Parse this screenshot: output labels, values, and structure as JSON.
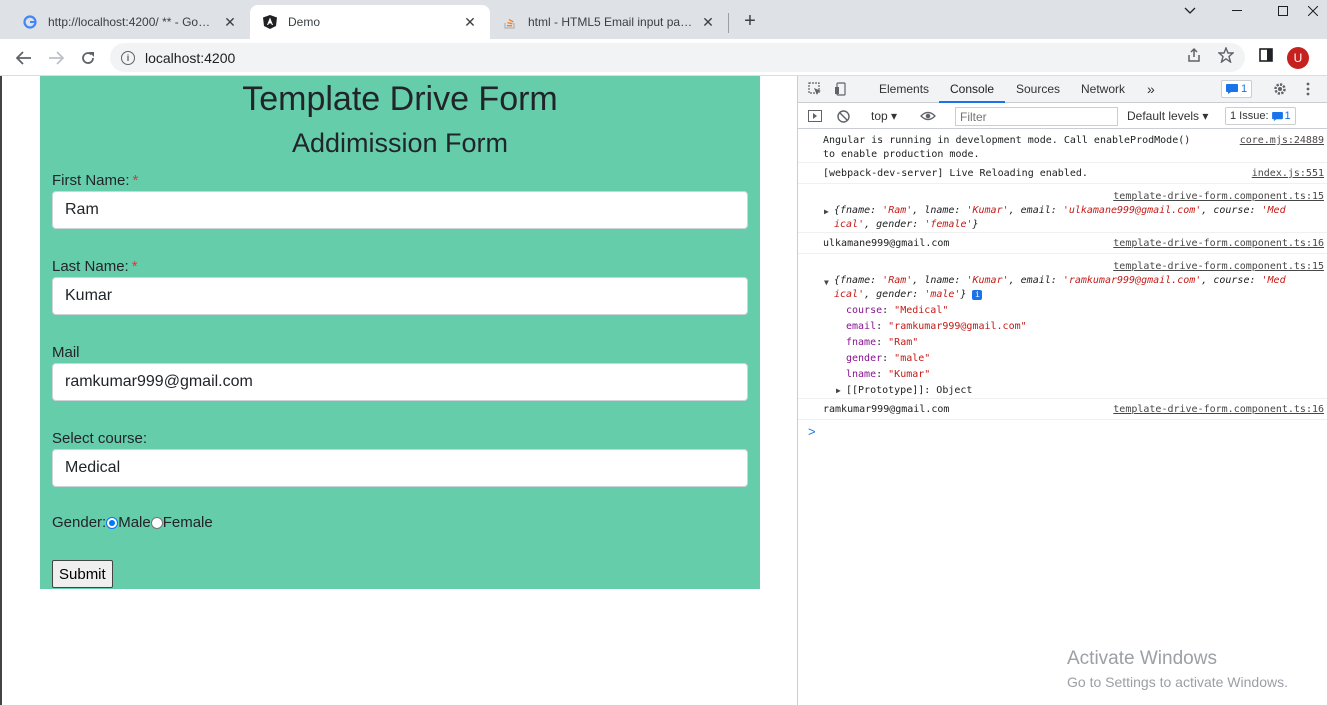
{
  "browser": {
    "tabs": [
      {
        "title": "http://localhost:4200/ ** - Google",
        "icon": "google-icon"
      },
      {
        "title": "Demo",
        "icon": "angular-icon",
        "active": true
      },
      {
        "title": "html - HTML5 Email input pattern",
        "icon": "stackoverflow-icon"
      }
    ],
    "url": "localhost:4200",
    "avatar_letter": "U"
  },
  "form": {
    "title": "Template Drive Form",
    "subtitle": "Addimission Form",
    "first_name_label": "First Name:",
    "first_name_value": "Ram",
    "last_name_label": "Last Name:",
    "last_name_value": "Kumar",
    "mail_label": "Mail",
    "mail_value": "ramkumar999@gmail.com",
    "course_label": "Select course:",
    "course_value": "Medical",
    "gender_label": "Gender:",
    "gender_male": "Male",
    "gender_female": "Female",
    "submit_label": "Submit",
    "required_mark": "*"
  },
  "devtools": {
    "tabs": [
      "Elements",
      "Console",
      "Sources",
      "Network"
    ],
    "more": "»",
    "message_badge": "1",
    "context": "top",
    "filter_placeholder": "Filter",
    "levels": "Default levels",
    "issues_label": "1 Issue:",
    "issues_count": "1",
    "console": {
      "line1a": "Angular is running in development mode. Call enableProdMode()",
      "line1b": "to enable production mode.",
      "src1": "core.mjs:24889",
      "line2": "[webpack-dev-server] Live Reloading enabled.",
      "src2": "index.js:551",
      "src3": "template-drive-form.component.ts:15",
      "obj1_open": "{fname: ",
      "obj1_fname": "'Ram'",
      "obj1_lname_key": ", lname: ",
      "obj1_lname": "'Kumar'",
      "obj1_email_key": ", email: ",
      "obj1_email": "'ulkamane999@gmail.com'",
      "obj1_course_key": ", course: ",
      "obj1_course": "'Med",
      "obj1_line2a": "ical'",
      "obj1_gender_key": ", gender: ",
      "obj1_gender": "'female'",
      "obj1_close": "}",
      "line4": "ulkamane999@gmail.com",
      "src4": "template-drive-form.component.ts:16",
      "src5": "template-drive-form.component.ts:15",
      "obj2_email": "'ramkumar999@gmail.com'",
      "obj2_gender": "'male'",
      "prop_course_key": "course",
      "prop_course": "\"Medical\"",
      "prop_email_key": "email",
      "prop_email": "\"ramkumar999@gmail.com\"",
      "prop_fname_key": "fname",
      "prop_fname": "\"Ram\"",
      "prop_gender_key": "gender",
      "prop_gender": "\"male\"",
      "prop_lname_key": "lname",
      "prop_lname": "\"Kumar\"",
      "prototype": "[[Prototype]]: Object",
      "line6": "ramkumar999@gmail.com",
      "src6": "template-drive-form.component.ts:16",
      "prompt": ">"
    }
  },
  "watermark": {
    "line1": "Activate Windows",
    "line2": "Go to Settings to activate Windows."
  }
}
